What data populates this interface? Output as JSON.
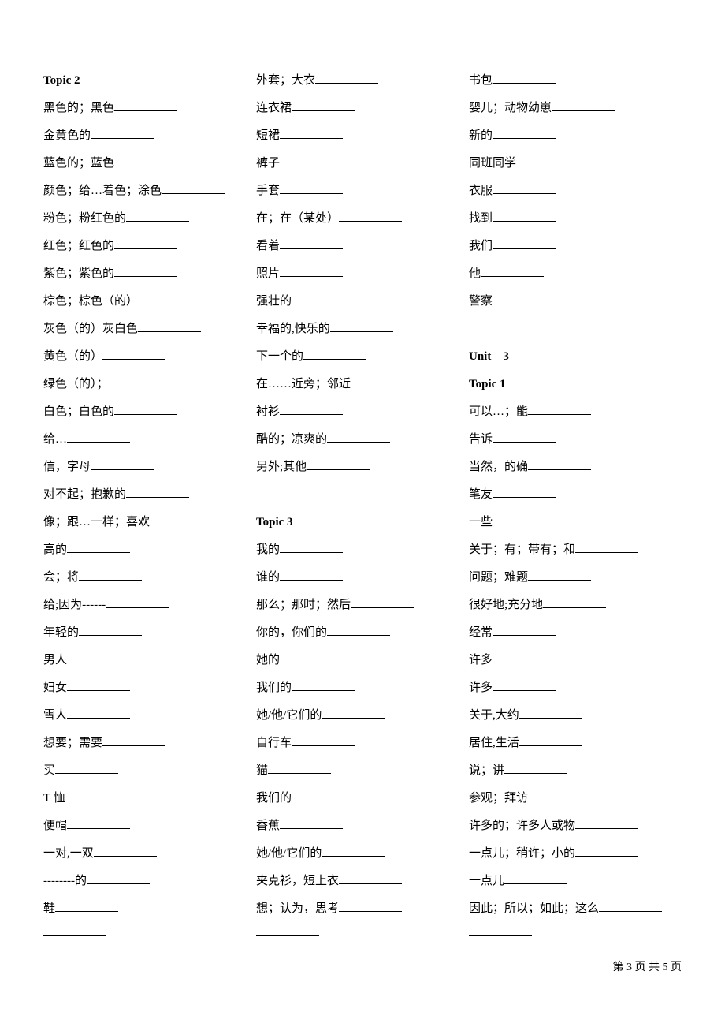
{
  "col1": [
    "Topic 2",
    "黑色的；黑色",
    "金黄色的",
    "蓝色的；蓝色",
    "颜色；给…着色；涂色",
    "粉色；粉红色的",
    "红色；红色的",
    "紫色；紫色的",
    "棕色；棕色（的）",
    "灰色（的）灰白色",
    "黄色（的）",
    "绿色（的）；",
    "白色；白色的",
    "给…",
    "信，字母",
    "对不起；抱歉的",
    "像；跟…一样；喜欢",
    "高的",
    "会；将",
    "给;因为------",
    "年轻的",
    "男人",
    "妇女",
    "雪人",
    "想要；需要",
    "买",
    "T 恤",
    "便帽",
    "一对,一双",
    "--------的",
    "鞋",
    ""
  ],
  "col2": [
    "外套；大衣",
    "连衣裙",
    "短裙",
    "裤子",
    "手套",
    "在；在（某处）",
    "看着",
    "照片",
    "强壮的",
    "幸福的,快乐的",
    "下一个的",
    "在……近旁；邻近",
    "衬衫",
    "酷的；凉爽的",
    "另外;其他",
    "",
    "Topic 3",
    "我的",
    "谁的",
    "那么；那时；然后",
    "你的，你们的",
    "她的",
    "我们的",
    "她/他/它们的",
    "自行车",
    "猫",
    "我们的",
    "香蕉",
    "她/他/它们的",
    "夹克衫，短上衣",
    "想；认为，思考",
    ""
  ],
  "col3": [
    "书包",
    "婴儿；动物幼崽",
    "新的",
    "同班同学",
    "衣服",
    "找到",
    "我们",
    "他",
    "警察",
    "",
    "Unit　3",
    "Topic 1",
    "可以…；能",
    "告诉",
    "当然，的确",
    "笔友",
    "一些",
    "关于；有；带有；和",
    "问题；难题",
    "很好地;充分地",
    "经常",
    "许多",
    "许多",
    "关于,大约",
    "居住,生活",
    "说；讲",
    "参观；拜访",
    "许多的；许多人或物",
    "一点儿；稍许；小的",
    "一点儿",
    "因此；所以；如此；这么",
    ""
  ],
  "footer": "第 3 页 共 5 页"
}
